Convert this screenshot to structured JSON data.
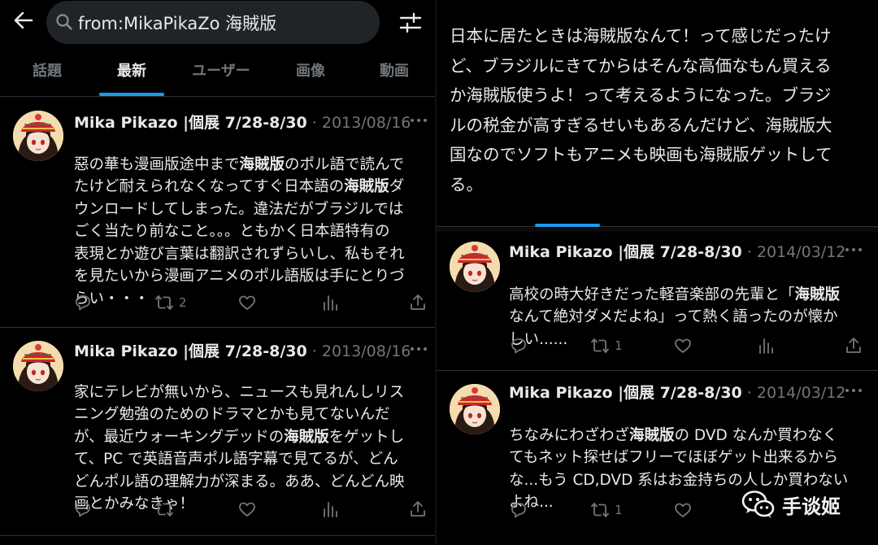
{
  "search": {
    "query": "from:MikaPikaZo 海賊版"
  },
  "tabs": [
    {
      "label": "話題"
    },
    {
      "label": "最新"
    },
    {
      "label": "ユーザー"
    },
    {
      "label": "画像"
    },
    {
      "label": "動画"
    }
  ],
  "tweets_left": [
    {
      "name": "Mika Pikazo |個展 7/28-8/30",
      "meta": " · 2013/08/16",
      "body_parts": [
        "惡の華も漫画版途中まで",
        "海賊版",
        "のポル語で読んで\nたけど耐えられなくなってすぐ日本語の",
        "海賊版",
        "ダ\nウンロードしてしまった。違法だがブラジルでは\nごく当たり前なこと。。。ともかく日本語特有の\n表現とか遊び言葉は翻訳されずらいし、私もそれ\nを見たいから漫画アニメのポル語版は手にとりづ\nらい・・・"
      ],
      "retweets": "2"
    },
    {
      "name": "Mika Pikazo |個展 7/28-8/30",
      "meta": " · 2013/08/16",
      "body_parts": [
        "家にテレビが無いから、ニュースも見れんしリス\nニング勉強のためのドラマとかも見てないんだ\nが、最近ウォーキングデッドの",
        "海賊版",
        "をゲットし\nて、PC で英語音声ポル語字幕で見てるが、どん\nどんポル語の理解力が深まる。ああ、どんどん映\n画とかみなきゃ！"
      ],
      "retweets": ""
    }
  ],
  "right_top_text": "日本に居たときは海賊版なんて！って感じだったけ\nど、ブラジルにきてからはそんな高価なもん買える\nか海賊版使うよ！って考えるようになった。ブラジ\nルの税金が高すぎるせいもあるんだけど、海賊版大\n国なのでソフトもアニメも映画も海賊版ゲットして\nる。",
  "tweets_right": [
    {
      "name": "Mika Pikazo |個展 7/28-8/30",
      "meta": " · 2014/03/12",
      "body_parts": [
        "高校の時大好きだった軽音楽部の先輩と「",
        "海賊版",
        "\nなんて絶対ダメだよね」って熱く語ったのが懐か\nしい......"
      ],
      "retweets": "1"
    },
    {
      "name": "Mika Pikazo |個展 7/28-8/30",
      "meta": " · 2014/03/12",
      "body_parts": [
        "ちなみにわざわざ",
        "海賊版",
        "の DVD なんか買わなく\nてもネット探せばフリーでほぼゲット出来るから\nな...もう CD,DVD 系はお金持ちの人しか買わない\nよね..."
      ],
      "retweets": "1"
    }
  ],
  "watermark": {
    "text": "手谈姬",
    "icon": "wechat-icon"
  },
  "colors": {
    "accent": "#1d9bf0",
    "muted": "#71767b",
    "text": "#e7e9ea",
    "background": "#000000"
  }
}
